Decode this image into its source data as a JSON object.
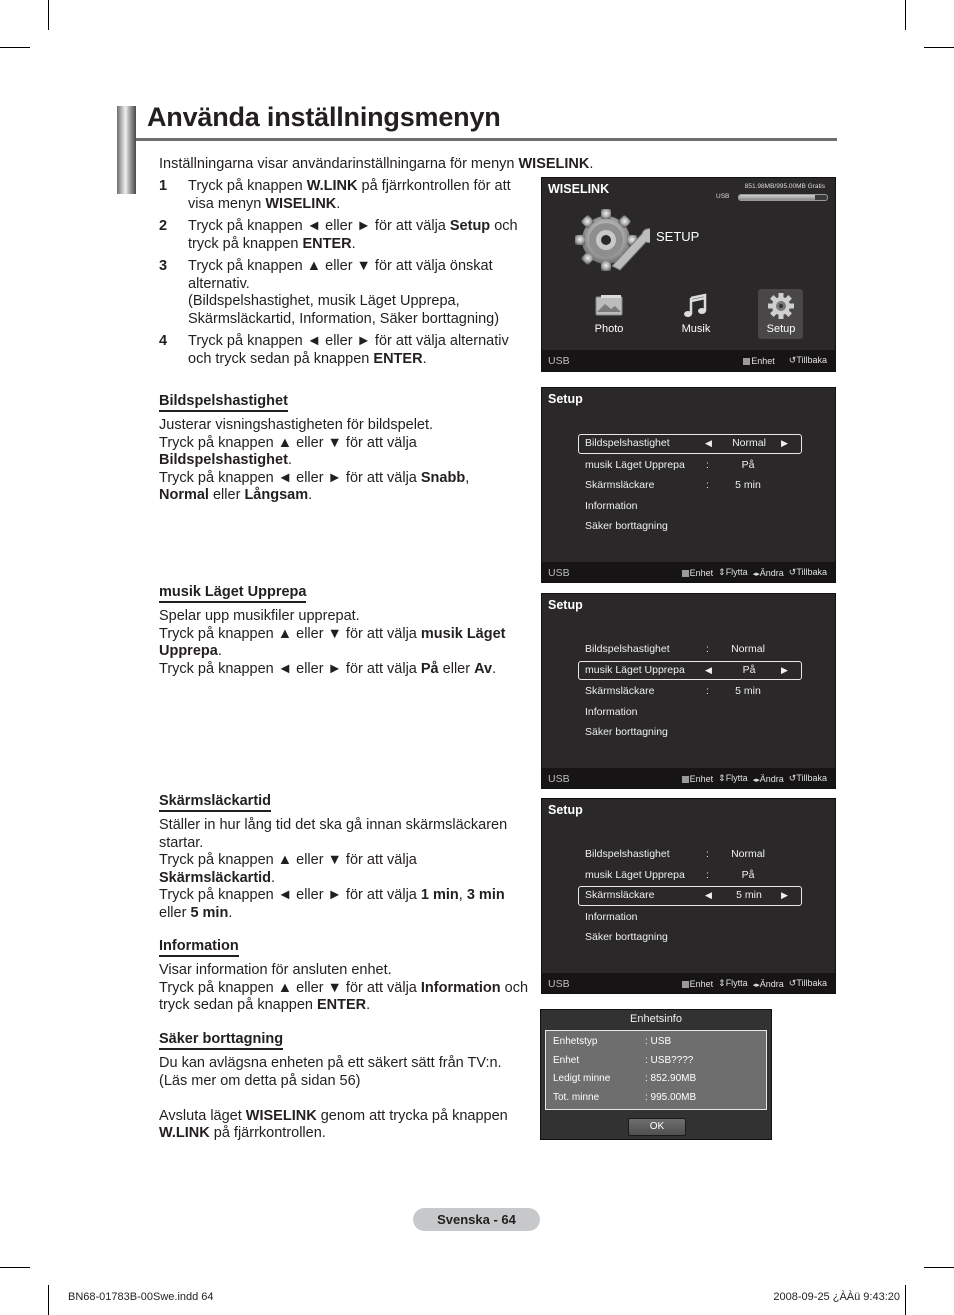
{
  "page": {
    "title": "Använda inställningsmenyn",
    "intro": {
      "pre": "Inställningarna visar användarinställningarna för menyn ",
      "bold": "WISELINK",
      "post": "."
    },
    "steps": [
      {
        "num": "1",
        "parts": [
          {
            "t": "Tryck på knappen "
          },
          {
            "b": "W.LINK"
          },
          {
            "t": " på fjärrkontrollen för att visa menyn "
          },
          {
            "b": "WISELINK"
          },
          {
            "t": "."
          }
        ]
      },
      {
        "num": "2",
        "parts": [
          {
            "t": "Tryck på knappen ◄ eller ► för att välja "
          },
          {
            "b": "Setup"
          },
          {
            "t": " och tryck på knappen "
          },
          {
            "b": "ENTER"
          },
          {
            "t": "."
          }
        ]
      },
      {
        "num": "3",
        "parts": [
          {
            "t": "Tryck på knappen ▲ eller ▼ för att välja önskat alternativ."
          },
          {
            "br": true
          },
          {
            "t": "(Bildspelshastighet, musik Läget Upprepa, Skärmsläckartid, Information, Säker borttagning)"
          }
        ]
      },
      {
        "num": "4",
        "parts": [
          {
            "t": "Tryck på knappen ◄ eller ► för att välja alternativ och tryck sedan på knappen "
          },
          {
            "b": "ENTER"
          },
          {
            "t": "."
          }
        ]
      }
    ],
    "sections": [
      {
        "heading": "Bildspelshastighet",
        "parts": [
          {
            "t": "Justerar visningshastigheten för bildspelet."
          },
          {
            "br": true
          },
          {
            "t": "Tryck på knappen ▲ eller ▼ för att välja "
          },
          {
            "br": true
          },
          {
            "b": "Bildspelshastighet"
          },
          {
            "t": "."
          },
          {
            "br": true
          },
          {
            "t": "Tryck på knappen ◄ eller ► för att välja "
          },
          {
            "b": "Snabb"
          },
          {
            "t": ", "
          },
          {
            "br": true
          },
          {
            "b": "Normal"
          },
          {
            "t": " eller "
          },
          {
            "b": "Långsam"
          },
          {
            "t": "."
          }
        ]
      },
      {
        "heading": "musik Läget Upprepa",
        "parts": [
          {
            "t": "Spelar upp musikfiler upprepat."
          },
          {
            "br": true
          },
          {
            "t": "Tryck på knappen ▲ eller ▼ för att välja "
          },
          {
            "b": "musik Läget Upprepa"
          },
          {
            "t": "."
          },
          {
            "br": true
          },
          {
            "t": "Tryck på knappen ◄ eller ► för att välja "
          },
          {
            "b": "På"
          },
          {
            "t": " eller "
          },
          {
            "b": "Av"
          },
          {
            "t": "."
          }
        ]
      },
      {
        "heading": "Skärmsläckartid",
        "parts": [
          {
            "t": "Ställer in hur lång tid det ska gå innan skärmsläckaren startar."
          },
          {
            "br": true
          },
          {
            "t": "Tryck på knappen ▲ eller ▼ för att välja "
          },
          {
            "br": true
          },
          {
            "b": "Skärmsläckartid"
          },
          {
            "t": "."
          },
          {
            "br": true
          },
          {
            "t": "Tryck på knappen ◄ eller ► för att välja "
          },
          {
            "b": "1 min"
          },
          {
            "t": ", "
          },
          {
            "b": "3 min"
          },
          {
            "t": " eller "
          },
          {
            "b": "5 min"
          },
          {
            "t": "."
          }
        ]
      },
      {
        "heading": "Information",
        "parts": [
          {
            "t": "Visar information för ansluten enhet."
          },
          {
            "br": true
          },
          {
            "t": "Tryck på knappen ▲ eller ▼ för att välja "
          },
          {
            "b": "Information"
          },
          {
            "t": " och tryck sedan på knappen "
          },
          {
            "b": "ENTER"
          },
          {
            "t": "."
          }
        ]
      },
      {
        "heading": "Säker borttagning",
        "parts": [
          {
            "t": "Du kan avlägsna enheten på ett säkert sätt från TV:n."
          },
          {
            "br": true
          },
          {
            "t": "(Läs mer om detta på sidan 56)"
          },
          {
            "gap": true
          },
          {
            "t": "Avsluta läget "
          },
          {
            "b": "WISELINK"
          },
          {
            "t": " genom att trycka på knappen "
          },
          {
            "b": "W.LINK"
          },
          {
            "t": " på fjärrkontrollen."
          }
        ]
      }
    ],
    "page_label": "Svenska - 64",
    "slug_left": "BN68-01783B-00Swe.indd   64",
    "slug_right": "2008-09-25   ¿ÀÀü 9:43:20"
  },
  "wiselink": {
    "title": "WISELINK",
    "storage_text": "851.98MB/995.00MB Gratis",
    "storage_device": "USB",
    "storage_free_fraction": 0.86,
    "selected_label": "SETUP",
    "apps": [
      {
        "label": "Photo",
        "icon": "photo-icon"
      },
      {
        "label": "Musik",
        "icon": "music-note-icon"
      },
      {
        "label": "Setup",
        "icon": "gear-icon",
        "selected": true
      }
    ],
    "footer": {
      "device": "USB",
      "hints": [
        {
          "icon": "square-button-icon",
          "label": "Enhet"
        },
        {
          "icon": "return-icon",
          "label": "Tillbaka"
        }
      ]
    }
  },
  "setup_screens": {
    "title": "Setup",
    "items": [
      "Bildspelshastighet",
      "musik Läget Upprepa",
      "Skärmsläckare",
      "Information",
      "Säker borttagning"
    ],
    "values": [
      "Normal",
      "På",
      "5 min",
      "",
      ""
    ],
    "footer": {
      "device": "USB",
      "hints": [
        {
          "icon": "square-button-icon",
          "label": "Enhet"
        },
        {
          "icon": "up-down-icon",
          "label": "Flytta"
        },
        {
          "icon": "left-right-icon",
          "label": "Ändra"
        },
        {
          "icon": "return-icon",
          "label": "Tillbaka"
        }
      ]
    },
    "selected_index_per_screen": [
      0,
      1,
      2
    ]
  },
  "device_info": {
    "title": "Enhetsinfo",
    "rows": [
      {
        "key": "Enhetstyp",
        "value": ": USB"
      },
      {
        "key": "Enhet",
        "value": ": USB????"
      },
      {
        "key": "Ledigt minne",
        "value": ": 852.90MB"
      },
      {
        "key": "Tot. minne",
        "value": ": 995.00MB"
      }
    ],
    "ok_label": "OK"
  }
}
